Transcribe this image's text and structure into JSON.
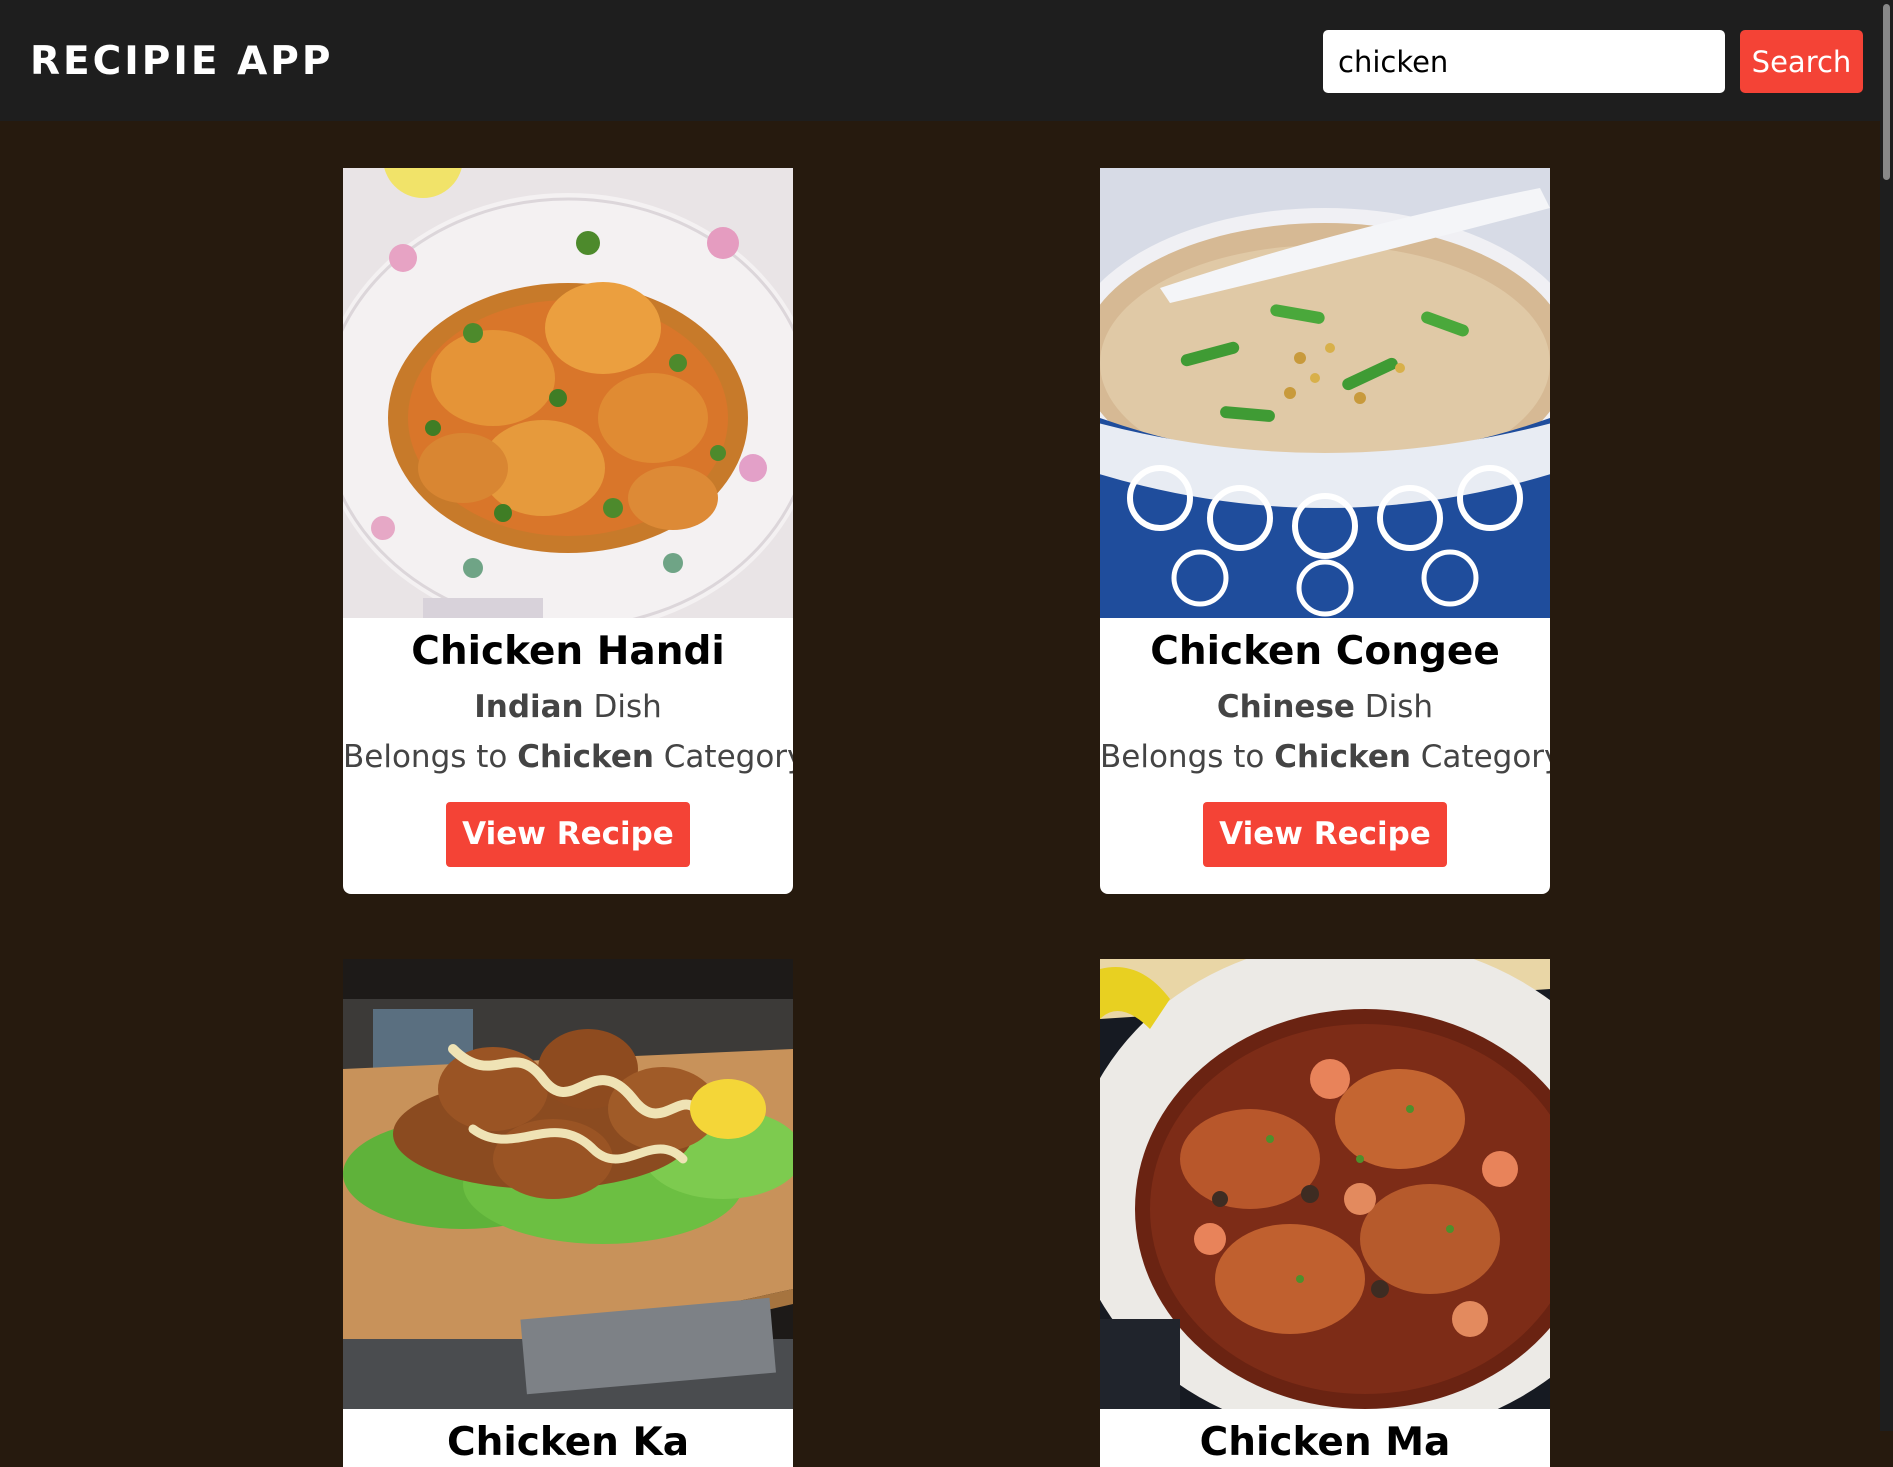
{
  "navbar": {
    "brand": "RECIPIE APP",
    "search_value": "chicken",
    "search_button_label": "Search"
  },
  "colors": {
    "background": "#261a0e",
    "navbar": "#1e1e1e",
    "accent": "#f44336"
  },
  "recipes": [
    {
      "title": "Chicken Handi",
      "area": "Indian",
      "area_suffix": " Dish",
      "category_prefix": "Belongs to ",
      "category": "Chicken",
      "category_suffix": " Category",
      "button_label": "View Recipe",
      "image": "chicken-curry-in-floral-bowl"
    },
    {
      "title": "Chicken Congee",
      "area": "Chinese",
      "area_suffix": " Dish",
      "category_prefix": "Belongs to ",
      "category": "Chicken",
      "category_suffix": " Category",
      "button_label": "View Recipe",
      "image": "rice-porridge-in-blue-bowl"
    },
    {
      "title": "Chicken Ka",
      "image": "fried-chicken-on-lettuce-board"
    },
    {
      "title": "Chicken Ma",
      "image": "braised-chicken-in-dutch-oven"
    }
  ]
}
